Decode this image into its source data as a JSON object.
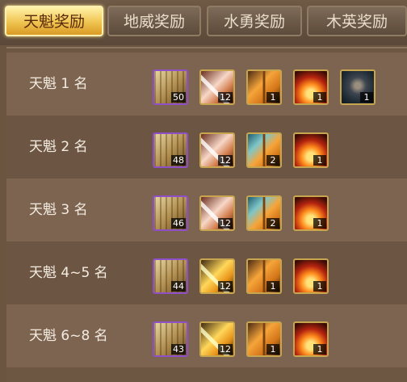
{
  "tabs": [
    {
      "label": "天魁奖励",
      "active": true
    },
    {
      "label": "地威奖励",
      "active": false
    },
    {
      "label": "水勇奖励",
      "active": false
    },
    {
      "label": "木英奖励",
      "active": false
    }
  ],
  "rows": [
    {
      "label": "天魁 1 名",
      "items": [
        {
          "icon": "treasure-chest-icon",
          "count": "50"
        },
        {
          "icon": "white-crystal-icon",
          "count": "12"
        },
        {
          "icon": "golden-book-icon",
          "count": "1"
        },
        {
          "icon": "fire-armor-icon",
          "count": "1"
        },
        {
          "icon": "dark-relic-icon",
          "count": "1"
        }
      ]
    },
    {
      "label": "天魁 2 名",
      "items": [
        {
          "icon": "treasure-chest-icon",
          "count": "48"
        },
        {
          "icon": "white-crystal-icon",
          "count": "12"
        },
        {
          "icon": "golden-book-icon",
          "count": "2"
        },
        {
          "icon": "fire-armor-icon",
          "count": "1"
        }
      ]
    },
    {
      "label": "天魁 3 名",
      "items": [
        {
          "icon": "treasure-chest-icon",
          "count": "46"
        },
        {
          "icon": "white-crystal-icon",
          "count": "12"
        },
        {
          "icon": "golden-book-icon",
          "count": "2"
        },
        {
          "icon": "fire-armor-icon",
          "count": "1"
        }
      ]
    },
    {
      "label": "天魁 4~5 名",
      "items": [
        {
          "icon": "treasure-chest-icon",
          "count": "44"
        },
        {
          "icon": "yellow-crystal-icon",
          "count": "12"
        },
        {
          "icon": "golden-book-icon",
          "count": "1"
        },
        {
          "icon": "fire-armor-icon",
          "count": "1"
        }
      ]
    },
    {
      "label": "天魁 6~8 名",
      "items": [
        {
          "icon": "treasure-chest-icon",
          "count": "43"
        },
        {
          "icon": "yellow-crystal-icon",
          "count": "12"
        },
        {
          "icon": "golden-book-icon",
          "count": "1"
        },
        {
          "icon": "fire-armor-icon",
          "count": "1"
        }
      ]
    }
  ]
}
